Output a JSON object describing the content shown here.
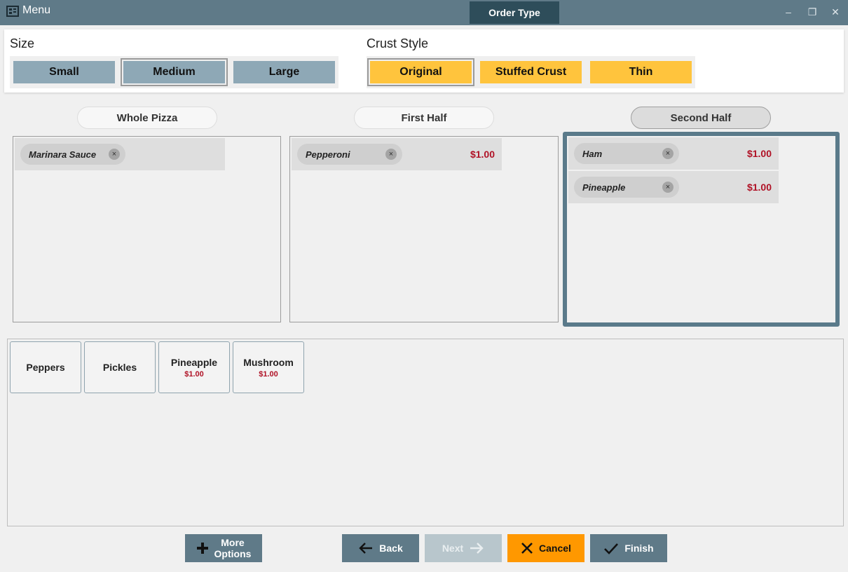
{
  "window": {
    "title": "Menu",
    "order_type_label": "Order Type",
    "minimize": "–",
    "restore": "❐",
    "close": "✕"
  },
  "size": {
    "label": "Size",
    "options": [
      "Small",
      "Medium",
      "Large"
    ],
    "selected": "Medium"
  },
  "crust": {
    "label": "Crust Style",
    "options": [
      "Original",
      "Stuffed Crust",
      "Thin"
    ],
    "selected": "Original"
  },
  "sections": {
    "whole": {
      "title": "Whole Pizza",
      "toppings": [
        {
          "name": "Marinara Sauce",
          "price": ""
        }
      ]
    },
    "first": {
      "title": "First Half",
      "toppings": [
        {
          "name": "Pepperoni",
          "price": "$1.00"
        }
      ]
    },
    "second": {
      "title": "Second Half",
      "toppings": [
        {
          "name": "Ham",
          "price": "$1.00"
        },
        {
          "name": "Pineapple",
          "price": "$1.00"
        }
      ]
    }
  },
  "active_section": "Second Half",
  "remove_glyph": "×",
  "available_toppings": [
    {
      "name": "Peppers",
      "price": ""
    },
    {
      "name": "Pickles",
      "price": ""
    },
    {
      "name": "Pineapple",
      "price": "$1.00"
    },
    {
      "name": "Mushroom",
      "price": "$1.00"
    }
  ],
  "buttons": {
    "more_options_line1": "More",
    "more_options_line2": "Options",
    "back": "Back",
    "next": "Next",
    "cancel": "Cancel",
    "finish": "Finish"
  },
  "colors": {
    "titlebar": "#5f7a88",
    "size_button": "#8ea8b6",
    "crust_button": "#ffc43d",
    "price": "#b01226",
    "cancel": "#ff9800",
    "next_disabled": "#b8c6cc"
  }
}
